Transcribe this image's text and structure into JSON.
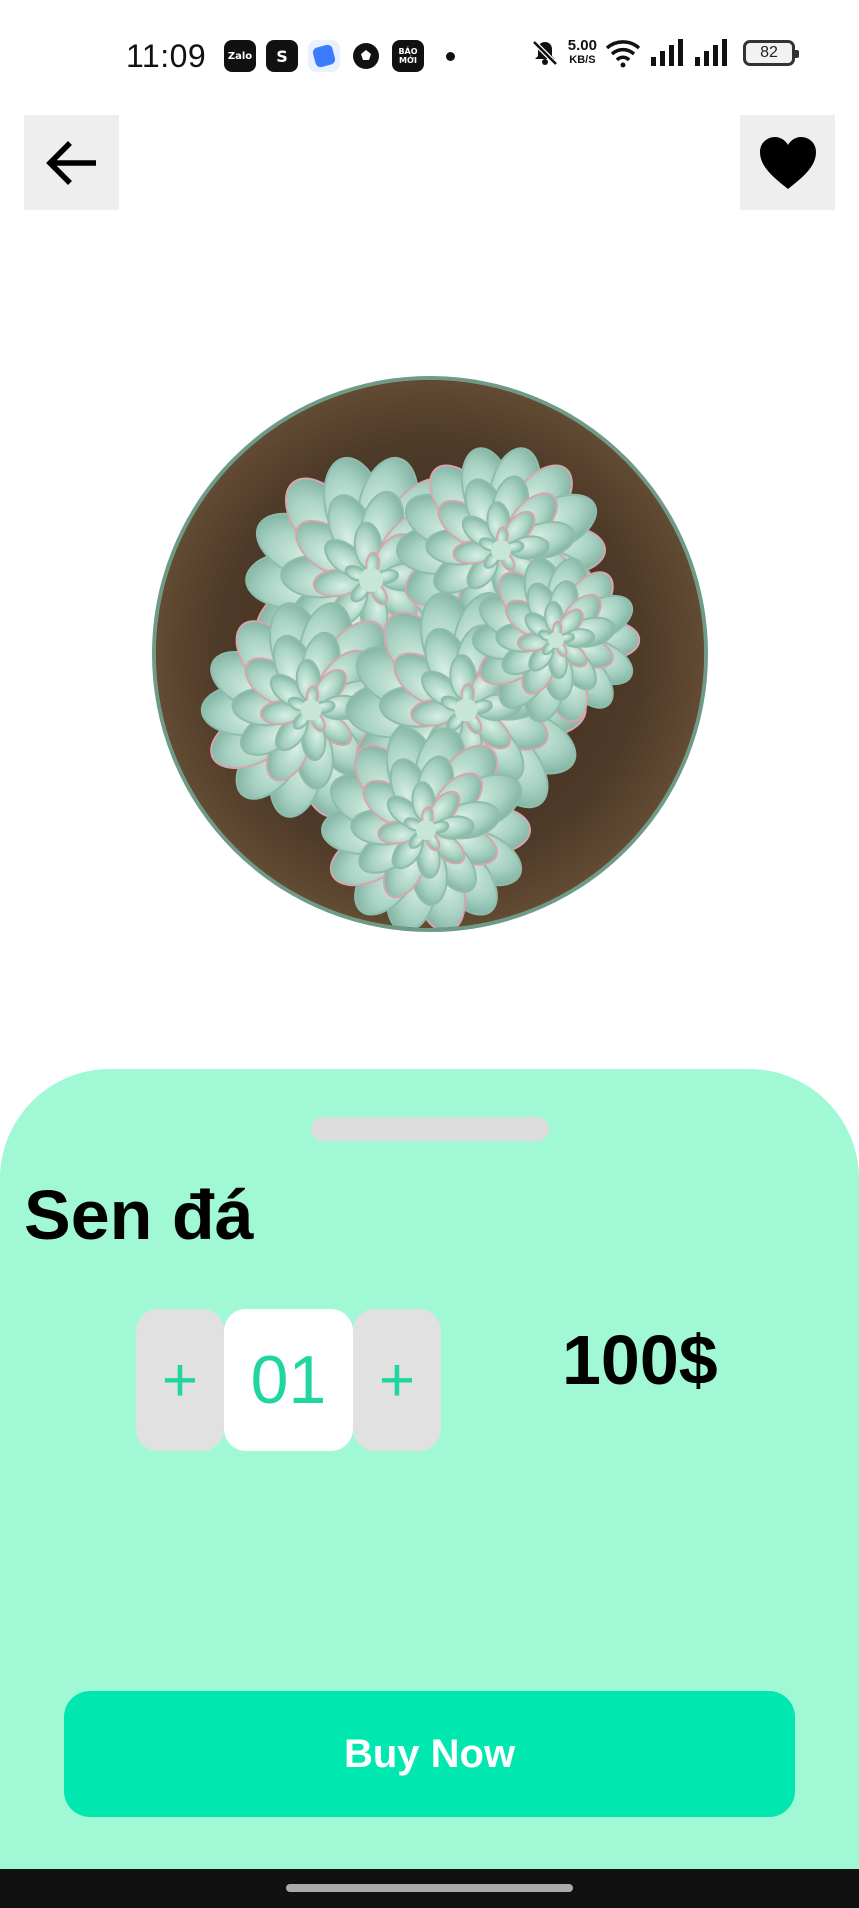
{
  "status_bar": {
    "time": "11:09",
    "notifications": [
      "Zalo",
      "S",
      "",
      "",
      "BÁO MỚI"
    ],
    "network_speed": "5.00",
    "network_speed_unit": "KB/S",
    "battery": "82",
    "icons": [
      "zalo-icon",
      "shopee-icon",
      "app-icon",
      "soccer-icon",
      "baomoi-icon",
      "mute-icon",
      "wifi-icon",
      "signal-icon",
      "signal-icon",
      "battery-icon"
    ]
  },
  "header": {
    "back_icon": "arrow-left-icon",
    "favorite_icon": "heart-icon"
  },
  "product": {
    "image": "succulent-photo",
    "name": "Sen đá",
    "price": "100$",
    "quantity": "01",
    "decrement_label": "+",
    "increment_label": "+"
  },
  "actions": {
    "buy_label": "Buy Now"
  },
  "colors": {
    "sheet_background": "#a0f8d5",
    "accent": "#1fd6a0",
    "button": "#00e7b0"
  }
}
